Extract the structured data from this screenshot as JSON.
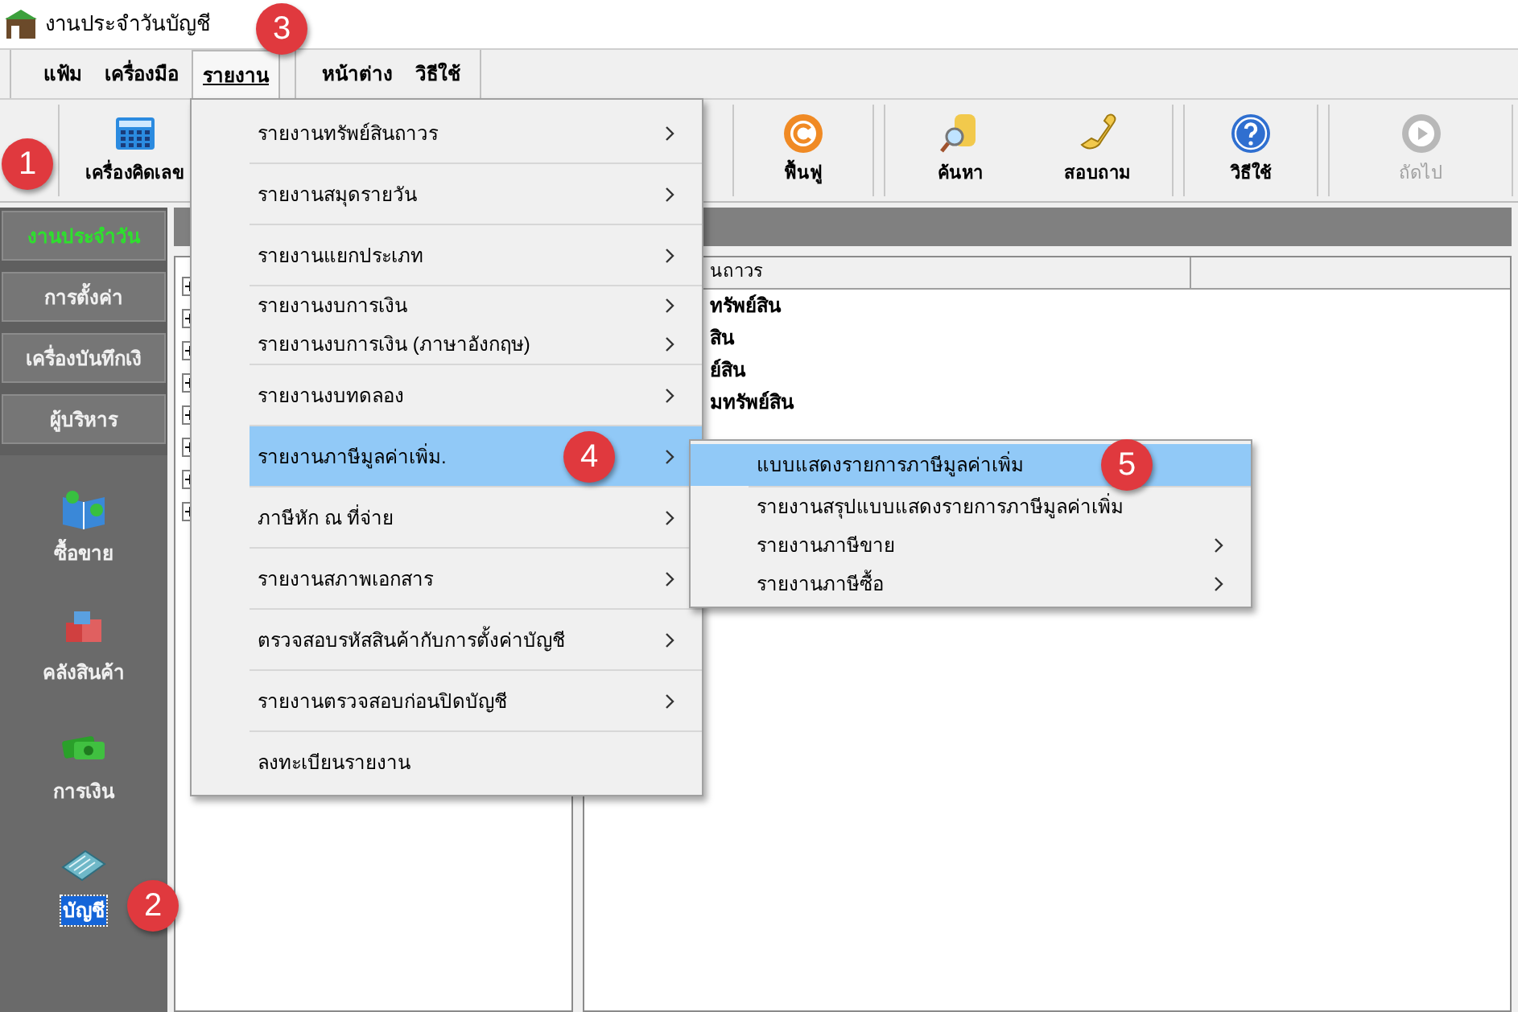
{
  "window": {
    "title": "งานประจำวันบัญชี"
  },
  "menu_bar": [
    {
      "label": "แฟ้ม",
      "selected": false
    },
    {
      "label": "เครื่องมือ",
      "selected": false
    },
    {
      "label": "รายงาน",
      "selected": true
    },
    {
      "label": "หน้าต่าง",
      "selected": false
    },
    {
      "label": "วิธีใช้",
      "selected": false
    }
  ],
  "toolbar": [
    {
      "label": "เครื่องคิดเลข",
      "disabled": false
    },
    {
      "label": "ฟื้นฟู",
      "disabled": false
    },
    {
      "label": "ค้นหา",
      "disabled": false
    },
    {
      "label": "สอบถาม",
      "disabled": false
    },
    {
      "label": "วิธีใช้",
      "disabled": false
    },
    {
      "label": "ถัดไป",
      "disabled": true
    }
  ],
  "sidebar": {
    "tabs": [
      {
        "label": "งานประจำวัน",
        "selected": true
      },
      {
        "label": "การตั้งค่า",
        "selected": false
      },
      {
        "label": "เครื่องบันทึกเงิ",
        "selected": false
      },
      {
        "label": "ผู้บริหาร",
        "selected": false
      }
    ],
    "modules": [
      {
        "label": "ซื้อขาย",
        "selected": false
      },
      {
        "label": "คลังสินค้า",
        "selected": false
      },
      {
        "label": "การเงิน",
        "selected": false
      },
      {
        "label": "บัญชี",
        "selected": true
      }
    ]
  },
  "tree": {
    "nodes": [
      {
        "expanded": false
      },
      {
        "expanded": false
      },
      {
        "expanded": false
      },
      {
        "expanded": false
      },
      {
        "expanded": false
      },
      {
        "expanded": false
      },
      {
        "expanded": false
      },
      {
        "expanded": false
      }
    ]
  },
  "list": {
    "column_1": "นถาวร",
    "rows": [
      "ทรัพย์สิน",
      "สิน",
      "ย์สิน",
      "มทรัพย์สิน"
    ]
  },
  "report_menu": {
    "groups": [
      [
        {
          "label": "รายงานทรัพย์สินถาวร",
          "submenu": true,
          "selected": false
        }
      ],
      [
        {
          "label": "รายงานสมุดรายวัน",
          "submenu": true,
          "selected": false
        }
      ],
      [
        {
          "label": "รายงานแยกประเภท",
          "submenu": true,
          "selected": false
        }
      ],
      [
        {
          "label": "รายงานงบการเงิน",
          "submenu": true,
          "selected": false
        },
        {
          "label": "รายงานงบการเงิน (ภาษาอังกฤษ)",
          "submenu": true,
          "selected": false
        }
      ],
      [
        {
          "label": "รายงานงบทดลอง",
          "submenu": true,
          "selected": false
        }
      ],
      [
        {
          "label": "รายงานภาษีมูลค่าเพิ่ม.",
          "submenu": true,
          "selected": true
        }
      ],
      [
        {
          "label": "ภาษีหัก ณ ที่จ่าย",
          "submenu": true,
          "selected": false
        }
      ],
      [
        {
          "label": "รายงานสภาพเอกสาร",
          "submenu": true,
          "selected": false
        }
      ],
      [
        {
          "label": "ตรวจสอบรหัสสินค้ากับการตั้งค่าบัญชี",
          "submenu": true,
          "selected": false
        }
      ],
      [
        {
          "label": "รายงานตรวจสอบก่อนปิดบัญชี",
          "submenu": true,
          "selected": false
        }
      ],
      [
        {
          "label": "ลงทะเบียนรายงาน",
          "submenu": false,
          "selected": false
        }
      ]
    ]
  },
  "vat_submenu": {
    "groups": [
      [
        {
          "label": "แบบแสดงรายการภาษีมูลค่าเพิ่ม",
          "submenu": false,
          "selected": true
        }
      ],
      [
        {
          "label": "รายงานสรุปแบบแสดงรายการภาษีมูลค่าเพิ่ม",
          "submenu": false,
          "selected": false
        },
        {
          "label": "รายงานภาษีขาย",
          "submenu": true,
          "selected": false
        },
        {
          "label": "รายงานภาษีซื้อ",
          "submenu": true,
          "selected": false
        }
      ]
    ]
  },
  "step_badges": [
    {
      "label": "1"
    },
    {
      "label": "2"
    },
    {
      "label": "3"
    },
    {
      "label": "4"
    },
    {
      "label": "5"
    }
  ]
}
